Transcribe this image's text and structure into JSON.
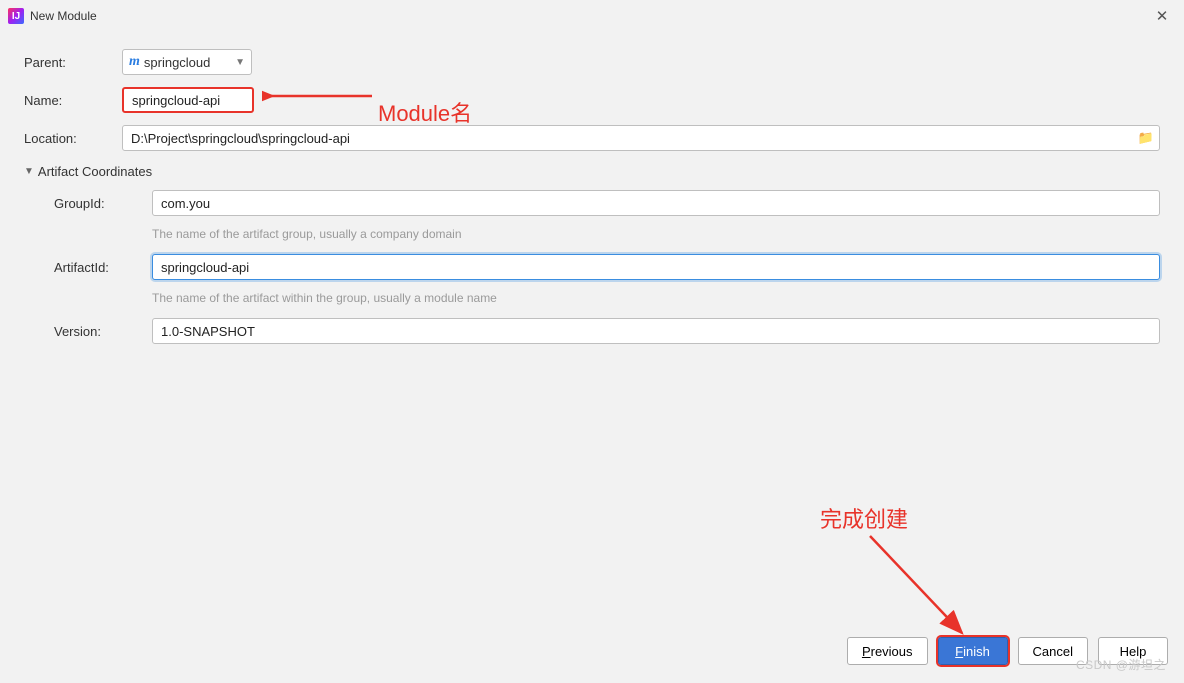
{
  "window": {
    "title": "New Module"
  },
  "form": {
    "parent": {
      "label": "Parent:",
      "value": "springcloud"
    },
    "name": {
      "label": "Name:",
      "value": "springcloud-api"
    },
    "location": {
      "label": "Location:",
      "value": "D:\\Project\\springcloud\\springcloud-api"
    },
    "section_title": "Artifact Coordinates",
    "groupId": {
      "label": "GroupId:",
      "value": "com.you",
      "hint": "The name of the artifact group, usually a company domain"
    },
    "artifactId": {
      "label": "ArtifactId:",
      "value": "springcloud-api",
      "hint": "The name of the artifact within the group, usually a module name"
    },
    "version": {
      "label": "Version:",
      "value": "1.0-SNAPSHOT"
    }
  },
  "buttons": {
    "previous": "Previous",
    "finish": "Finish",
    "cancel": "Cancel",
    "help": "Help"
  },
  "annotations": {
    "module_name": "Module名",
    "finish_hint": "完成创建"
  },
  "watermark": "CSDN @游坦之"
}
